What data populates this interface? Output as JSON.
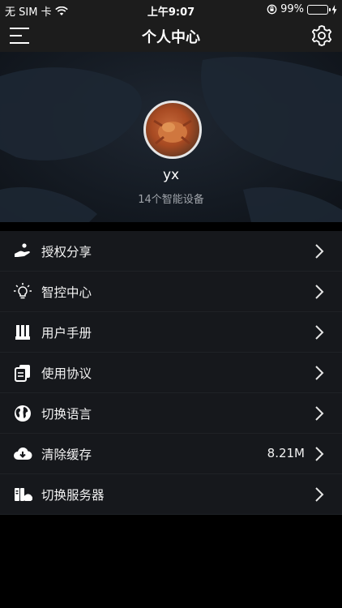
{
  "status_bar": {
    "carrier": "无 SIM 卡",
    "time": "上午9:07",
    "battery": "99%",
    "battery_level": 0.99,
    "battery_color": "#4cd964"
  },
  "nav": {
    "title": "个人中心",
    "menu_icon": "hamburger-icon",
    "settings_icon": "gear-icon"
  },
  "profile": {
    "username": "yx",
    "devices": "14个智能设备"
  },
  "menu": [
    {
      "label": "授权分享",
      "icon": "hand-share-icon",
      "value": ""
    },
    {
      "label": "智控中心",
      "icon": "lightbulb-icon",
      "value": ""
    },
    {
      "label": "用户手册",
      "icon": "manual-book-icon",
      "value": ""
    },
    {
      "label": "使用协议",
      "icon": "document-icon",
      "value": ""
    },
    {
      "label": "切换语言",
      "icon": "globe-icon",
      "value": ""
    },
    {
      "label": "清除缓存",
      "icon": "cloud-download-icon",
      "value": "8.21M"
    },
    {
      "label": "切换服务器",
      "icon": "server-icon",
      "value": ""
    }
  ]
}
